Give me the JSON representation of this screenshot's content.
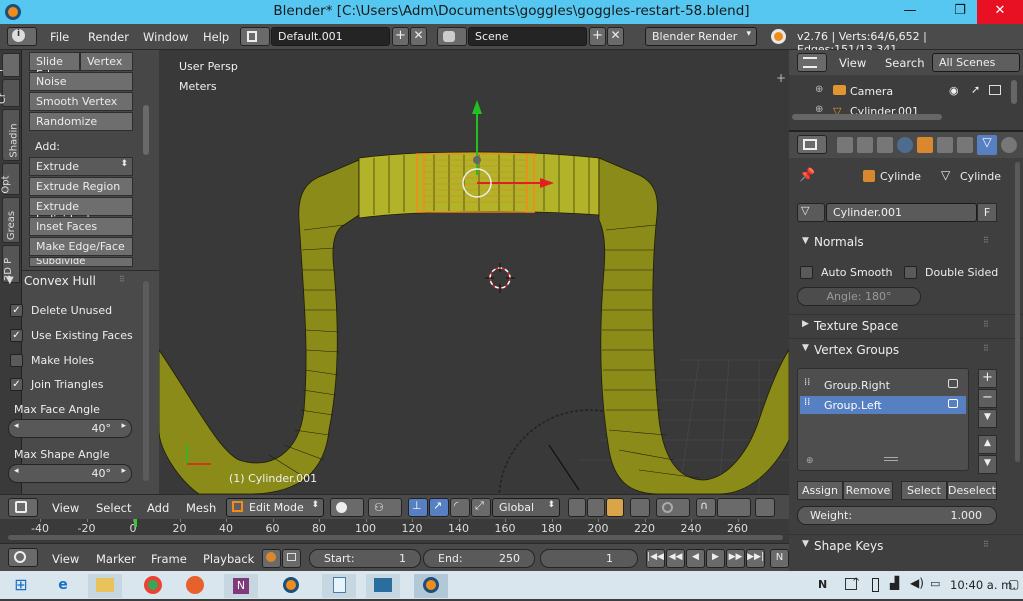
{
  "window": {
    "title": "Blender* [C:\\Users\\Adm\\Documents\\goggles\\goggles-restart-58.blend]",
    "minimize": "—",
    "maximize": "❐",
    "close": "✕"
  },
  "infobar": {
    "menus": [
      "File",
      "Render",
      "Window",
      "Help"
    ],
    "screen_layout": "Default.001",
    "scene": "Scene",
    "render_engine": "Blender Render",
    "stats": "v2.76 | Verts:64/6,652 | Edges:151/13,341"
  },
  "tabs": [
    "T",
    "Cr",
    "Shadin",
    "Opt",
    "Greas",
    "3D P"
  ],
  "toolshelf": {
    "row1": [
      "Slide Ed",
      "Vertex"
    ],
    "buttons_top": [
      "Noise",
      "Smooth Vertex",
      "Randomize"
    ],
    "add_label": "Add:",
    "extrude": "Extrude",
    "buttons_add": [
      "Extrude Region",
      "Extrude Individual",
      "Inset Faces",
      "Make Edge/Face",
      "Subdivide"
    ],
    "convex_hull_title": "Convex Hull",
    "checkboxes": [
      {
        "label": "Delete Unused",
        "checked": true
      },
      {
        "label": "Use Existing Faces",
        "checked": true
      },
      {
        "label": "Make Holes",
        "checked": false
      },
      {
        "label": "Join Triangles",
        "checked": true
      }
    ],
    "max_face_label": "Max Face Angle",
    "max_face_value": "40°",
    "max_shape_label": "Max Shape Angle",
    "max_shape_value": "40°"
  },
  "viewport": {
    "view_name": "User Persp",
    "units": "Meters",
    "object_label": "(1) Cylinder.001"
  },
  "outliner": {
    "menus": [
      "View",
      "Search"
    ],
    "scope": "All Scenes",
    "items": [
      "Camera",
      "Cylinder.001"
    ]
  },
  "properties": {
    "breadcrumb": [
      "Cylinde",
      "Cylinde"
    ],
    "mesh_name": "Cylinder.001",
    "fake_user": "F",
    "normals_title": "Normals",
    "auto_smooth": "Auto Smooth",
    "double_sided": "Double Sided",
    "angle": "Angle:  180°",
    "texture_space": "Texture Space",
    "vertex_groups_title": "Vertex Groups",
    "vertex_groups": [
      {
        "name": "Group.Right",
        "selected": false
      },
      {
        "name": "Group.Left",
        "selected": true
      }
    ],
    "vg_buttons": [
      "Assign",
      "Remove",
      "Select",
      "Deselect"
    ],
    "weight_label": "Weight:",
    "weight_value": "1.000",
    "shape_keys_title": "Shape Keys"
  },
  "viewport_header": {
    "menus": [
      "View",
      "Select",
      "Add",
      "Mesh"
    ],
    "mode": "Edit Mode",
    "orientation": "Global"
  },
  "timeline": {
    "ticks": [
      "-40",
      "-20",
      "0",
      "20",
      "40",
      "60",
      "80",
      "100",
      "120",
      "140",
      "160",
      "180",
      "200",
      "220",
      "240",
      "260"
    ],
    "menus": [
      "View",
      "Marker",
      "Frame",
      "Playback"
    ],
    "start_label": "Start:",
    "start_value": "1",
    "end_label": "End:",
    "end_value": "250",
    "current_frame": "1",
    "no_sync": "N"
  },
  "taskbar": {
    "time": "10:40 a. m.",
    "lang": "N"
  },
  "colors": {
    "accent_blue": "#5680c2",
    "mesh_yellow": "#8b8b1a",
    "selection_orange": "#f08c1a",
    "title_bar": "#55c7f0"
  }
}
